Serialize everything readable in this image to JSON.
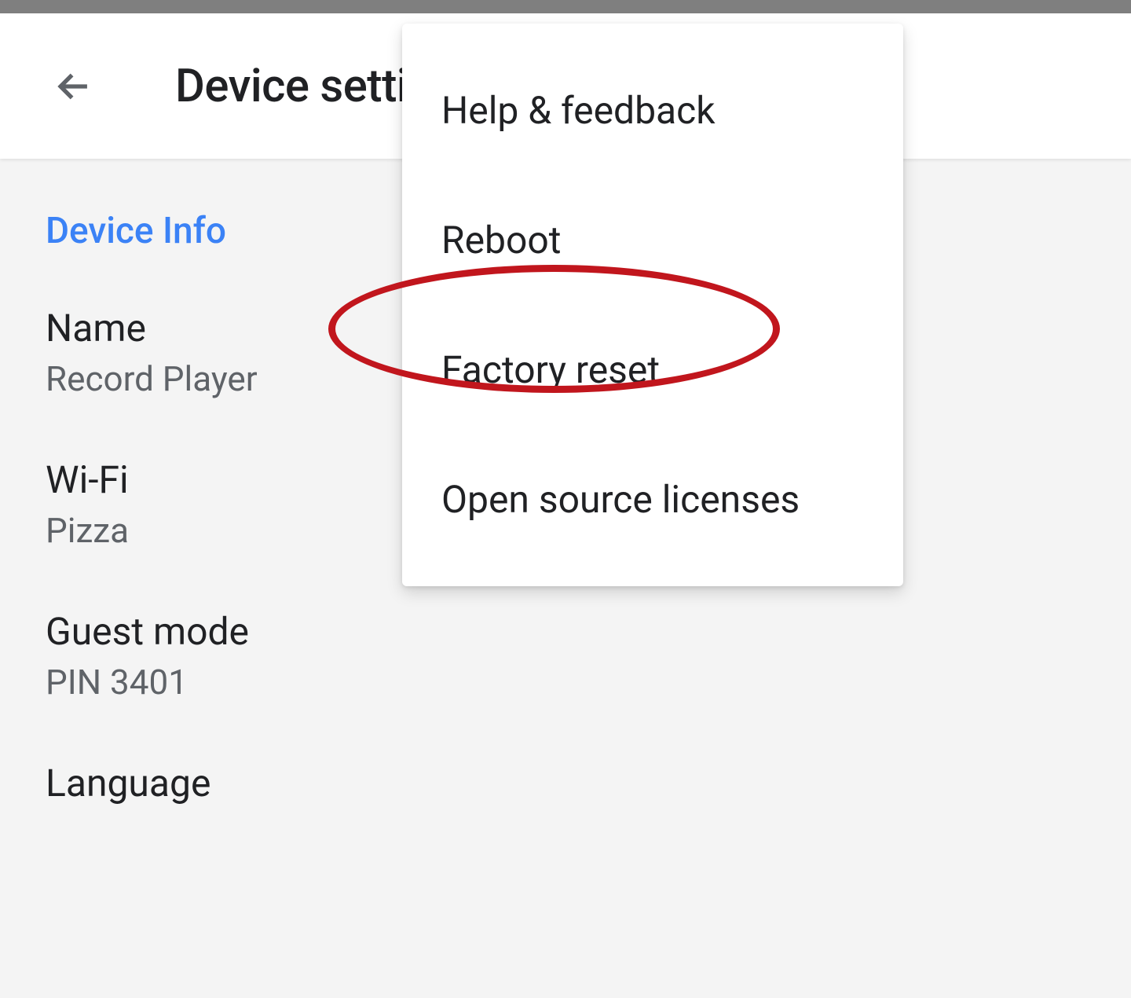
{
  "header": {
    "title": "Device settings"
  },
  "section": {
    "header": "Device Info"
  },
  "settings": {
    "name": {
      "label": "Name",
      "value": "Record Player"
    },
    "wifi": {
      "label": "Wi-Fi",
      "value": "Pizza"
    },
    "guest": {
      "label": "Guest mode",
      "value": "PIN 3401"
    },
    "language": {
      "label": "Language"
    }
  },
  "menu": {
    "items": [
      "Help & feedback",
      "Reboot",
      "Factory reset",
      "Open source licenses"
    ]
  }
}
